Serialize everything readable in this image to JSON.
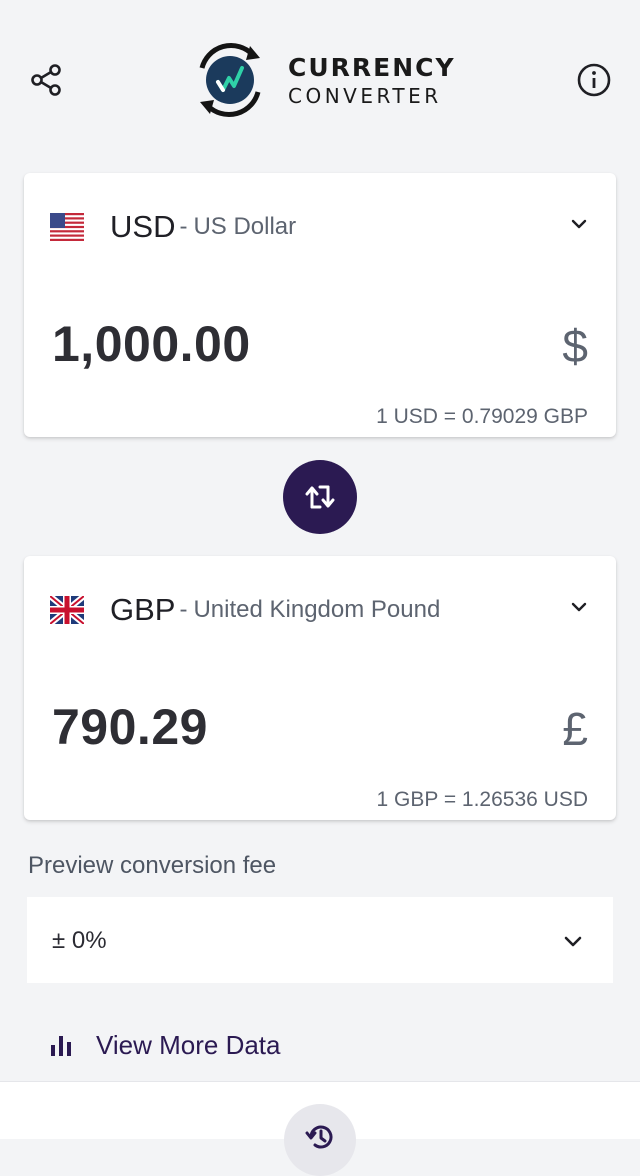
{
  "header": {
    "title_line1": "CURRENCY",
    "title_line2": "CONVERTER",
    "share_icon": "share-icon",
    "info_icon": "info-icon"
  },
  "from": {
    "code": "USD",
    "separator": "-",
    "name": "US Dollar",
    "amount": "1,000.00",
    "symbol": "$",
    "rate": "1 USD = 0.79029 GBP",
    "flag": "us-flag-icon"
  },
  "to": {
    "code": "GBP",
    "separator": "-",
    "name": "United Kingdom Pound",
    "amount": "790.29",
    "symbol": "£",
    "rate": "1 GBP = 1.26536 USD",
    "flag": "uk-flag-icon"
  },
  "swap": {
    "icon": "swap-arrows-icon"
  },
  "fee": {
    "label": "Preview conversion fee",
    "selected": "± 0%"
  },
  "more_data": {
    "label": "View More Data",
    "icon": "bar-chart-icon"
  },
  "colors": {
    "accent": "#2b1a52",
    "logo_teal": "#2fd1a8",
    "background": "#f3f4f6"
  }
}
